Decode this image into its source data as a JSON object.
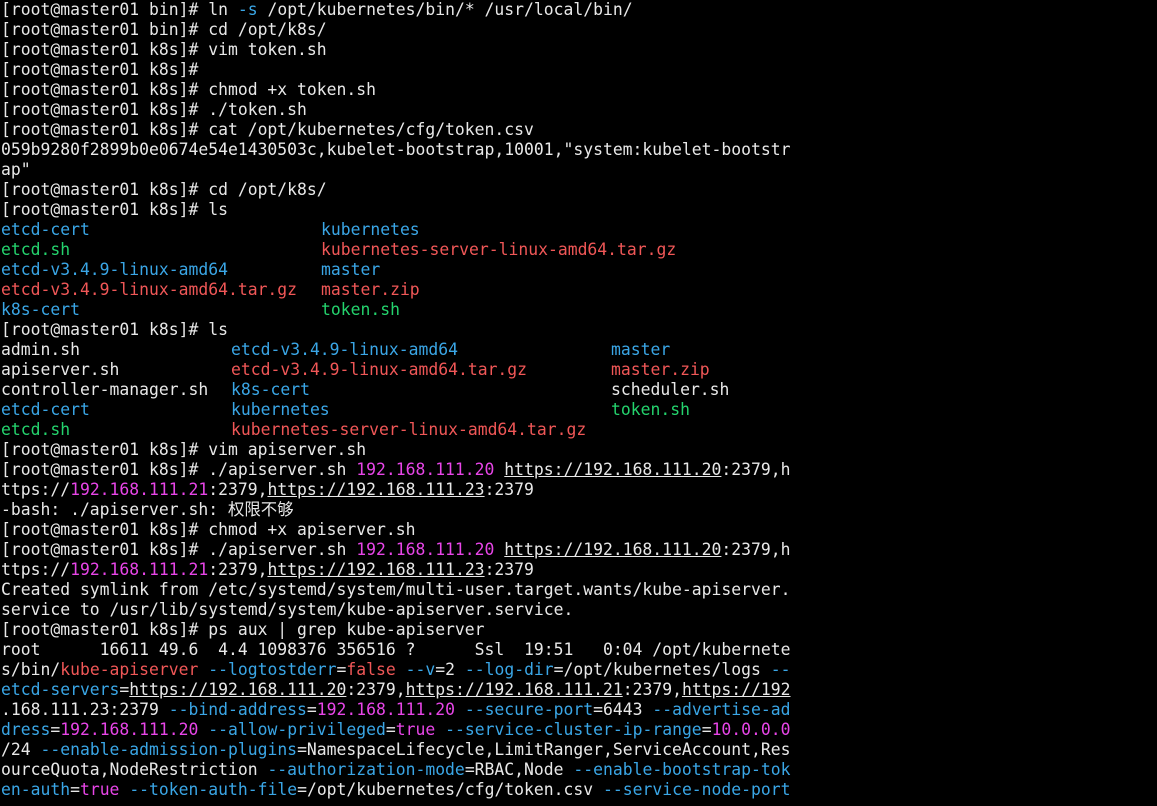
{
  "colors": {
    "background": "#000000",
    "default": "#e8e8e8",
    "dir": "#3aa6e6",
    "exec": "#24d36d",
    "archive": "#f05757",
    "ip": "#e845e8",
    "match": "#f05757",
    "opt": "#3aa6e6",
    "bool": "#e845e8"
  },
  "lines": [
    {
      "type": "text",
      "segs": [
        {
          "t": "[root@master01 bin]# ln "
        },
        {
          "t": "-s",
          "c": "opt"
        },
        {
          "t": " /opt/kubernetes/bin/* /usr/local/bin/"
        }
      ]
    },
    {
      "type": "text",
      "segs": [
        {
          "t": "[root@master01 bin]# cd /opt/k8s/"
        }
      ]
    },
    {
      "type": "text",
      "segs": [
        {
          "t": "[root@master01 k8s]# vim token.sh"
        }
      ]
    },
    {
      "type": "text",
      "segs": [
        {
          "t": "[root@master01 k8s]# "
        }
      ]
    },
    {
      "type": "text",
      "segs": [
        {
          "t": "[root@master01 k8s]# chmod +x token.sh"
        }
      ]
    },
    {
      "type": "text",
      "segs": [
        {
          "t": "[root@master01 k8s]# ./token.sh"
        }
      ]
    },
    {
      "type": "text",
      "segs": [
        {
          "t": "[root@master01 k8s]# cat /opt/kubernetes/cfg/token.csv"
        }
      ]
    },
    {
      "type": "text",
      "segs": [
        {
          "t": "059b9280f2899b0e0674e54e1430503c,kubelet-bootstrap,10001,\"system:kubelet-bootstr"
        }
      ]
    },
    {
      "type": "text",
      "segs": [
        {
          "t": "ap\""
        }
      ]
    },
    {
      "type": "text",
      "segs": [
        {
          "t": "[root@master01 k8s]# cd /opt/k8s/"
        }
      ]
    },
    {
      "type": "text",
      "segs": [
        {
          "t": "[root@master01 k8s]# ls"
        }
      ]
    },
    {
      "type": "cols",
      "widths": [
        320
      ],
      "cells": [
        {
          "t": "etcd-cert",
          "c": "dir"
        },
        {
          "t": "kubernetes",
          "c": "dir"
        }
      ]
    },
    {
      "type": "cols",
      "widths": [
        320
      ],
      "cells": [
        {
          "t": "etcd.sh",
          "c": "exec"
        },
        {
          "t": "kubernetes-server-linux-amd64.tar.gz",
          "c": "archive"
        }
      ]
    },
    {
      "type": "cols",
      "widths": [
        320
      ],
      "cells": [
        {
          "t": "etcd-v3.4.9-linux-amd64",
          "c": "dir"
        },
        {
          "t": "master",
          "c": "dir"
        }
      ]
    },
    {
      "type": "cols",
      "widths": [
        320
      ],
      "cells": [
        {
          "t": "etcd-v3.4.9-linux-amd64.tar.gz",
          "c": "archive"
        },
        {
          "t": "master.zip",
          "c": "archive"
        }
      ]
    },
    {
      "type": "cols",
      "widths": [
        320
      ],
      "cells": [
        {
          "t": "k8s-cert",
          "c": "dir"
        },
        {
          "t": "token.sh",
          "c": "exec"
        }
      ]
    },
    {
      "type": "text",
      "segs": [
        {
          "t": "[root@master01 k8s]# ls"
        }
      ]
    },
    {
      "type": "cols",
      "widths": [
        230,
        380
      ],
      "cells": [
        {
          "t": "admin.sh"
        },
        {
          "t": "etcd-v3.4.9-linux-amd64",
          "c": "dir"
        },
        {
          "t": "master",
          "c": "dir"
        }
      ]
    },
    {
      "type": "cols",
      "widths": [
        230,
        380
      ],
      "cells": [
        {
          "t": "apiserver.sh"
        },
        {
          "t": "etcd-v3.4.9-linux-amd64.tar.gz",
          "c": "archive"
        },
        {
          "t": "master.zip",
          "c": "archive"
        }
      ]
    },
    {
      "type": "cols",
      "widths": [
        230,
        380
      ],
      "cells": [
        {
          "t": "controller-manager.sh"
        },
        {
          "t": "k8s-cert",
          "c": "dir"
        },
        {
          "t": "scheduler.sh"
        }
      ]
    },
    {
      "type": "cols",
      "widths": [
        230,
        380
      ],
      "cells": [
        {
          "t": "etcd-cert",
          "c": "dir"
        },
        {
          "t": "kubernetes",
          "c": "dir"
        },
        {
          "t": "token.sh",
          "c": "exec"
        }
      ]
    },
    {
      "type": "cols",
      "widths": [
        230,
        380
      ],
      "cells": [
        {
          "t": "etcd.sh",
          "c": "exec"
        },
        {
          "t": "kubernetes-server-linux-amd64.tar.gz",
          "c": "archive"
        },
        {
          "t": ""
        }
      ]
    },
    {
      "type": "text",
      "segs": [
        {
          "t": "[root@master01 k8s]# vim apiserver.sh"
        }
      ]
    },
    {
      "type": "text",
      "segs": [
        {
          "t": "[root@master01 k8s]# ./apiserver.sh "
        },
        {
          "t": "192.168.111.20",
          "c": "ip"
        },
        {
          "t": " "
        },
        {
          "t": "https://192.168.111.20",
          "u": true
        },
        {
          "t": ":2379,h"
        }
      ]
    },
    {
      "type": "text",
      "segs": [
        {
          "t": "ttps://"
        },
        {
          "t": "192.168.111.21",
          "c": "ip"
        },
        {
          "t": ":2379,"
        },
        {
          "t": "https://192.168.111.23",
          "u": true
        },
        {
          "t": ":2379"
        }
      ]
    },
    {
      "type": "text",
      "segs": [
        {
          "t": "-bash: ./apiserver.sh: 权限不够"
        }
      ]
    },
    {
      "type": "text",
      "segs": [
        {
          "t": "[root@master01 k8s]# chmod +x apiserver.sh"
        }
      ]
    },
    {
      "type": "text",
      "segs": [
        {
          "t": "[root@master01 k8s]# ./apiserver.sh "
        },
        {
          "t": "192.168.111.20",
          "c": "ip"
        },
        {
          "t": " "
        },
        {
          "t": "https://192.168.111.20",
          "u": true
        },
        {
          "t": ":2379,h"
        }
      ]
    },
    {
      "type": "text",
      "segs": [
        {
          "t": "ttps://"
        },
        {
          "t": "192.168.111.21",
          "c": "ip"
        },
        {
          "t": ":2379,"
        },
        {
          "t": "https://192.168.111.23",
          "u": true
        },
        {
          "t": ":2379"
        }
      ]
    },
    {
      "type": "text",
      "segs": [
        {
          "t": "Created symlink from /etc/systemd/system/multi-user.target.wants/kube-apiserver."
        }
      ]
    },
    {
      "type": "text",
      "segs": [
        {
          "t": "service to /usr/lib/systemd/system/kube-apiserver.service."
        }
      ]
    },
    {
      "type": "text",
      "segs": [
        {
          "t": "[root@master01 k8s]# ps aux | grep kube-apiserver"
        }
      ]
    },
    {
      "type": "text",
      "segs": [
        {
          "t": "root      16611 49.6  4.4 1098376 356516 ?      Ssl  19:51   0:04 /opt/kubernete"
        }
      ]
    },
    {
      "type": "text",
      "segs": [
        {
          "t": "s/bin/"
        },
        {
          "t": "kube-apiserver",
          "c": "match"
        },
        {
          "t": " "
        },
        {
          "t": "--logtostderr",
          "c": "opt"
        },
        {
          "t": "="
        },
        {
          "t": "false",
          "c": "match"
        },
        {
          "t": " "
        },
        {
          "t": "--v",
          "c": "opt"
        },
        {
          "t": "=2 "
        },
        {
          "t": "--log-dir",
          "c": "opt"
        },
        {
          "t": "=/opt/kubernetes/logs "
        },
        {
          "t": "--",
          "c": "opt"
        }
      ]
    },
    {
      "type": "text",
      "segs": [
        {
          "t": "etcd-servers",
          "c": "opt"
        },
        {
          "t": "="
        },
        {
          "t": "https://192.168.111.20",
          "u": true
        },
        {
          "t": ":2379,"
        },
        {
          "t": "https://192.168.111.21",
          "u": true
        },
        {
          "t": ":2379,"
        },
        {
          "t": "https://192",
          "u": true
        }
      ]
    },
    {
      "type": "text",
      "segs": [
        {
          "t": ".168.111.23:2379 "
        },
        {
          "t": "--bind-address",
          "c": "opt"
        },
        {
          "t": "="
        },
        {
          "t": "192.168.111.20",
          "c": "ip"
        },
        {
          "t": " "
        },
        {
          "t": "--secure-port",
          "c": "opt"
        },
        {
          "t": "=6443 "
        },
        {
          "t": "--advertise-ad",
          "c": "opt"
        }
      ]
    },
    {
      "type": "text",
      "segs": [
        {
          "t": "dress",
          "c": "opt"
        },
        {
          "t": "="
        },
        {
          "t": "192.168.111.20",
          "c": "ip"
        },
        {
          "t": " "
        },
        {
          "t": "--allow-privileged",
          "c": "opt"
        },
        {
          "t": "="
        },
        {
          "t": "true",
          "c": "bool"
        },
        {
          "t": " "
        },
        {
          "t": "--service-cluster-ip-range",
          "c": "opt"
        },
        {
          "t": "="
        },
        {
          "t": "10.0.0.0",
          "c": "ip"
        }
      ]
    },
    {
      "type": "text",
      "segs": [
        {
          "t": "/24 "
        },
        {
          "t": "--enable-admission-plugins",
          "c": "opt"
        },
        {
          "t": "=NamespaceLifecycle,LimitRanger,ServiceAccount,Res"
        }
      ]
    },
    {
      "type": "text",
      "segs": [
        {
          "t": "ourceQuota,NodeRestriction "
        },
        {
          "t": "--authorization-mode",
          "c": "opt"
        },
        {
          "t": "=RBAC,Node "
        },
        {
          "t": "--enable-bootstrap-tok",
          "c": "opt"
        }
      ]
    },
    {
      "type": "text",
      "segs": [
        {
          "t": "en-auth",
          "c": "opt"
        },
        {
          "t": "="
        },
        {
          "t": "true",
          "c": "bool"
        },
        {
          "t": " "
        },
        {
          "t": "--token-auth-file",
          "c": "opt"
        },
        {
          "t": "=/opt/kubernetes/cfg/token.csv "
        },
        {
          "t": "--service-node-port",
          "c": "opt"
        }
      ]
    }
  ]
}
